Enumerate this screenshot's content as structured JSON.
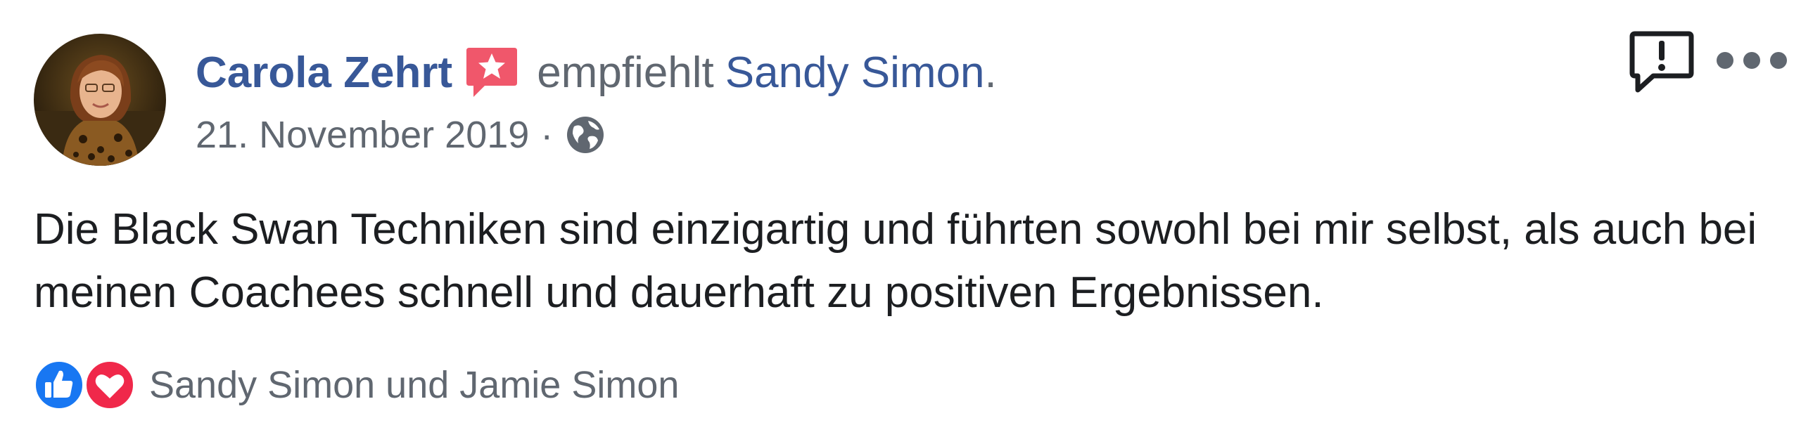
{
  "post": {
    "author_name": "Carola Zehrt",
    "recommendation_verb": "empfiehlt",
    "recommended_page": "Sandy Simon",
    "recommended_suffix": ".",
    "date": "21. November 2019",
    "separator": "·",
    "audience_icon": "globe-icon",
    "text": "Die Black Swan Techniken sind einzigartig und führten sowohl bei mir selbst, als auch bei meinen Coachees schnell und dauerhaft zu positiven Ergebnissen."
  },
  "actions": {
    "report_icon": "report-speech-bubble-icon",
    "more_icon": "more-options-icon"
  },
  "reactions": {
    "icons": [
      "like-icon",
      "love-icon"
    ],
    "names": "Sandy Simon und Jamie Simon"
  },
  "colors": {
    "link": "#385898",
    "secondary_text": "#606770",
    "body_text": "#1c1e21",
    "like_blue": "#1877f2",
    "love_red": "#f0284a",
    "recommend_badge": "#f0576b"
  }
}
